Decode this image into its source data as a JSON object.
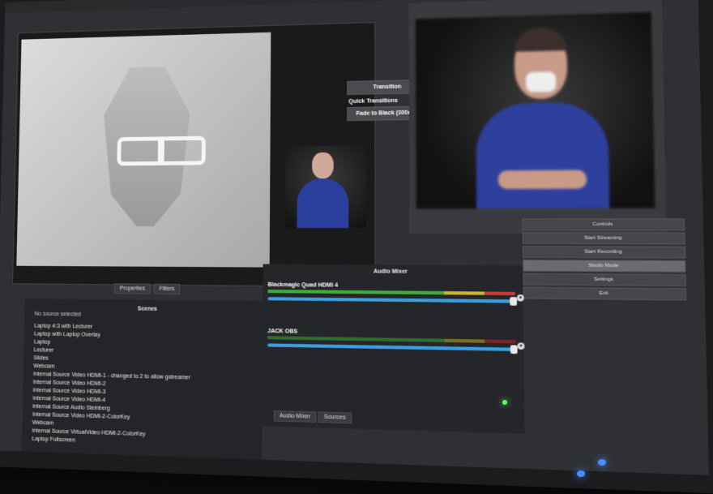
{
  "transition": {
    "button_label": "Transition",
    "quick_label": "Quick Transitions",
    "fade_label": "Fade to Black (300ms)"
  },
  "source_tabs": {
    "properties": "Properties",
    "filters": "Filters"
  },
  "scenes": {
    "no_source": "No source selected",
    "title": "Scenes",
    "items": [
      "Laptop 4:3 with Lecturer",
      "Laptop with Laptop Overlay",
      "Laptop",
      "Lecturer",
      "Slides",
      "Webcam",
      "Internal Source Video HDMI-1 - changed to 2 to allow gstreamer",
      "Internal Source Video HDMI-2",
      "Internal Source Video HDMI-3",
      "Internal Source Video HDMI-4",
      "Internal Source Audio Steinberg",
      "Internal Source Video HDMI-2-ColorKey",
      "Webcam",
      "Internal Source VirtualVideo HDMI-2-ColorKey",
      "Laptop Fullscreen"
    ]
  },
  "audio": {
    "title": "Audio Mixer",
    "channels": [
      {
        "name": "Blackmagic Quad HDMI 4",
        "level": 0.9,
        "volume": 0.96
      },
      {
        "name": "JACK OBS",
        "level": 0.0,
        "volume": 0.96
      }
    ],
    "tab_mixer": "Audio Mixer",
    "tab_sources": "Sources"
  },
  "controls": {
    "buttons": [
      "Controls",
      "Start Streaming",
      "Start Recording",
      "Studio Mode",
      "Settings",
      "Exit"
    ],
    "active_index": 3
  },
  "colors": {
    "accent_blue": "#3a9fe0",
    "meter_green": "#3fae3f",
    "meter_red": "#c73a3a"
  }
}
